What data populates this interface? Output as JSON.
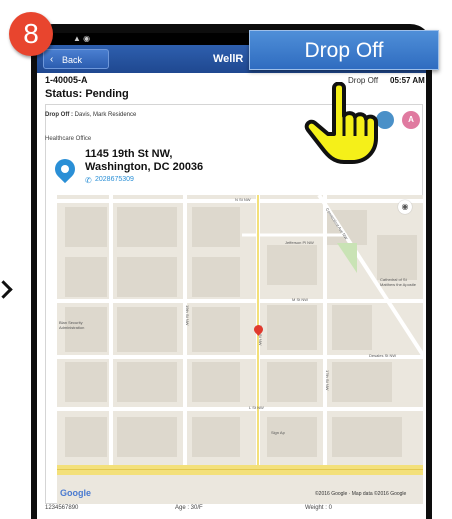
{
  "callout": {
    "step_number": "8",
    "action_label": "Drop Off"
  },
  "appbar": {
    "back_label": "Back",
    "title": "WellR"
  },
  "trip": {
    "id": "1-40005-A",
    "status": "Status: Pending",
    "time_label": "Drop Off",
    "time": "05:57 AM"
  },
  "card": {
    "dropoff_label": "Drop Off :",
    "dropoff_value": "Davis, Mark Residence",
    "office_label": "Healthcare Office",
    "address_line1": "1145 19th St NW,",
    "address_line2": "Washington, DC 20036",
    "phone": "2028675309",
    "avatar_initial": "A"
  },
  "map": {
    "streets": [
      "N St NW",
      "Jefferson Pl NW",
      "M St NW",
      "Desales St NW",
      "L St NW",
      "18th St NW",
      "19th St NW",
      "Connecticut Ave NW",
      "17th St NW",
      "Sign Ap",
      "Cathedral of St Matthew the Apostle",
      "Blan Security Administration"
    ],
    "google_label": "Google",
    "credit": "©2016 Google · Map data ©2016 Google"
  },
  "footer": {
    "phone": "1234567890",
    "age": "Age : 30/F",
    "weight": "Weight : 0"
  },
  "colors": {
    "appbar": "#2e5fae",
    "badge": "#e8452e",
    "action_button": "#3a7bcc",
    "pointer": "#f5f019"
  }
}
